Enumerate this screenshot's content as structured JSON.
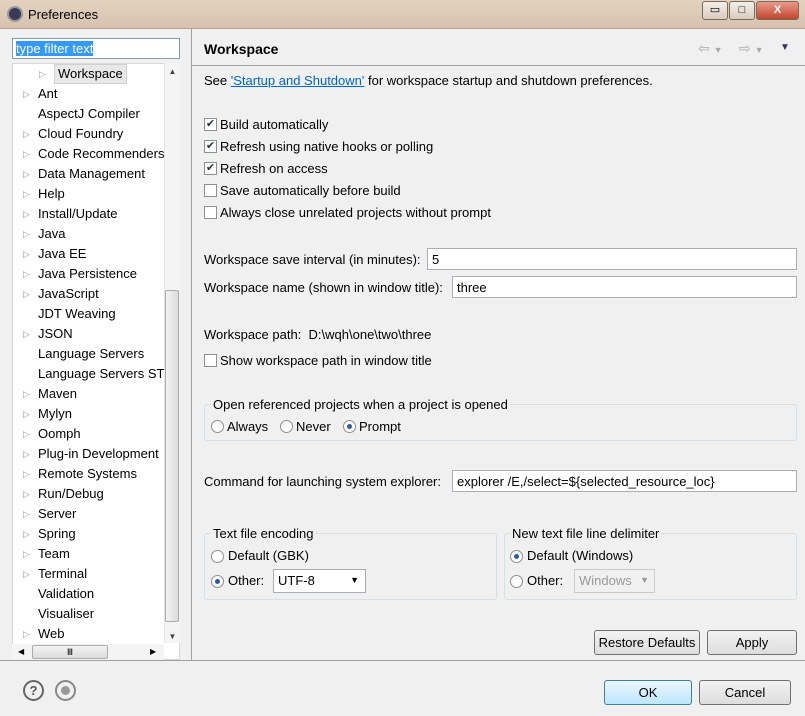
{
  "window": {
    "title": "Preferences",
    "minimize": "▭",
    "maximize": "□",
    "close": "X"
  },
  "sidebar": {
    "filter_placeholder": "type filter text",
    "items": [
      {
        "label": "Workspace",
        "expandable": true,
        "selected": true,
        "indent": 1
      },
      {
        "label": "Ant",
        "expandable": true
      },
      {
        "label": "AspectJ Compiler",
        "expandable": false
      },
      {
        "label": "Cloud Foundry",
        "expandable": true
      },
      {
        "label": "Code Recommenders",
        "expandable": true
      },
      {
        "label": "Data Management",
        "expandable": true
      },
      {
        "label": "Help",
        "expandable": true
      },
      {
        "label": "Install/Update",
        "expandable": true
      },
      {
        "label": "Java",
        "expandable": true
      },
      {
        "label": "Java EE",
        "expandable": true
      },
      {
        "label": "Java Persistence",
        "expandable": true
      },
      {
        "label": "JavaScript",
        "expandable": true
      },
      {
        "label": "JDT Weaving",
        "expandable": false
      },
      {
        "label": "JSON",
        "expandable": true
      },
      {
        "label": "Language Servers",
        "expandable": false
      },
      {
        "label": "Language Servers STS",
        "expandable": false
      },
      {
        "label": "Maven",
        "expandable": true
      },
      {
        "label": "Mylyn",
        "expandable": true
      },
      {
        "label": "Oomph",
        "expandable": true
      },
      {
        "label": "Plug-in Development",
        "expandable": true
      },
      {
        "label": "Remote Systems",
        "expandable": true
      },
      {
        "label": "Run/Debug",
        "expandable": true
      },
      {
        "label": "Server",
        "expandable": true
      },
      {
        "label": "Spring",
        "expandable": true
      },
      {
        "label": "Team",
        "expandable": true
      },
      {
        "label": "Terminal",
        "expandable": true
      },
      {
        "label": "Validation",
        "expandable": false
      },
      {
        "label": "Visualiser",
        "expandable": false
      },
      {
        "label": "Web",
        "expandable": true
      }
    ]
  },
  "page": {
    "title": "Workspace",
    "intro_prefix": "See ",
    "intro_link": "'Startup and Shutdown'",
    "intro_suffix": " for workspace startup and shutdown preferences.",
    "checkboxes": [
      {
        "label": "Build automatically",
        "checked": true
      },
      {
        "label": "Refresh using native hooks or polling",
        "checked": true
      },
      {
        "label": "Refresh on access",
        "checked": true
      },
      {
        "label": "Save automatically before build",
        "checked": false
      },
      {
        "label": "Always close unrelated projects without prompt",
        "checked": false
      }
    ],
    "save_interval_label": "Workspace save interval (in minutes):",
    "save_interval_value": "5",
    "name_label": "Workspace name (shown in window title):",
    "name_value": "three",
    "path_label": "Workspace path:",
    "path_value": "D:\\wqh\\one\\two\\three",
    "show_path_label": "Show workspace path in window title",
    "show_path_checked": false,
    "open_ref_group": "Open referenced projects when a project is opened",
    "open_ref_options": [
      "Always",
      "Never",
      "Prompt"
    ],
    "open_ref_selected": "Prompt",
    "explorer_label": "Command for launching system explorer:",
    "explorer_value": "explorer /E,/select=${selected_resource_loc}",
    "encoding_group": "Text file encoding",
    "encoding_default": "Default (GBK)",
    "encoding_other": "Other:",
    "encoding_value": "UTF-8",
    "encoding_selected": "Other",
    "delim_group": "New text file line delimiter",
    "delim_default": "Default (Windows)",
    "delim_other": "Other:",
    "delim_value": "Windows",
    "delim_selected": "Default",
    "restore_defaults": "Restore Defaults",
    "apply": "Apply"
  },
  "footer": {
    "ok": "OK",
    "cancel": "Cancel",
    "help_icon": "?"
  }
}
